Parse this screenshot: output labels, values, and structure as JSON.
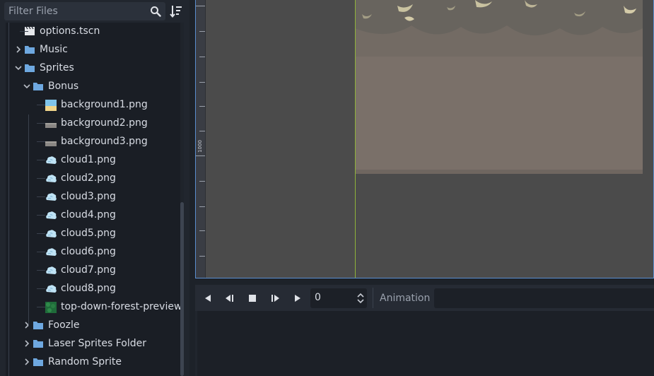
{
  "filesystem": {
    "filter_placeholder": "Filter Files",
    "items": [
      {
        "label": "options.tscn",
        "icon": "scene-icon",
        "depth": 1,
        "arrow": "none"
      },
      {
        "label": "Music",
        "icon": "folder-icon",
        "depth": 1,
        "arrow": "collapsed"
      },
      {
        "label": "Sprites",
        "icon": "folder-icon",
        "depth": 1,
        "arrow": "expanded"
      },
      {
        "label": "Bonus",
        "icon": "folder-icon",
        "depth": 2,
        "arrow": "expanded"
      },
      {
        "label": "background1.png",
        "icon": "image-sky-icon",
        "depth": 3,
        "arrow": "none"
      },
      {
        "label": "background2.png",
        "icon": "image-ground-icon",
        "depth": 3,
        "arrow": "none"
      },
      {
        "label": "background3.png",
        "icon": "image-ground-icon",
        "depth": 3,
        "arrow": "none"
      },
      {
        "label": "cloud1.png",
        "icon": "cloud-icon",
        "depth": 3,
        "arrow": "none"
      },
      {
        "label": "cloud2.png",
        "icon": "cloud-icon",
        "depth": 3,
        "arrow": "none"
      },
      {
        "label": "cloud3.png",
        "icon": "cloud-icon",
        "depth": 3,
        "arrow": "none"
      },
      {
        "label": "cloud4.png",
        "icon": "cloud-icon",
        "depth": 3,
        "arrow": "none"
      },
      {
        "label": "cloud5.png",
        "icon": "cloud-icon",
        "depth": 3,
        "arrow": "none"
      },
      {
        "label": "cloud6.png",
        "icon": "cloud-icon",
        "depth": 3,
        "arrow": "none"
      },
      {
        "label": "cloud7.png",
        "icon": "cloud-icon",
        "depth": 3,
        "arrow": "none"
      },
      {
        "label": "cloud8.png",
        "icon": "cloud-icon",
        "depth": 3,
        "arrow": "none"
      },
      {
        "label": "top-down-forest-preview.pn",
        "icon": "image-forest-icon",
        "depth": 3,
        "arrow": "none"
      },
      {
        "label": "Foozle",
        "icon": "folder-icon",
        "depth": 2,
        "arrow": "collapsed"
      },
      {
        "label": "Laser Sprites Folder",
        "icon": "folder-icon",
        "depth": 2,
        "arrow": "collapsed"
      },
      {
        "label": "Random Sprite",
        "icon": "folder-icon",
        "depth": 2,
        "arrow": "collapsed"
      }
    ]
  },
  "viewport": {
    "ruler_label": "1000"
  },
  "animation_panel": {
    "frame_value": "0",
    "animation_label": "Animation"
  },
  "colors": {
    "folder": "#6ea8e0",
    "accent": "#5a8ecf",
    "guide": "#8fb33a"
  }
}
